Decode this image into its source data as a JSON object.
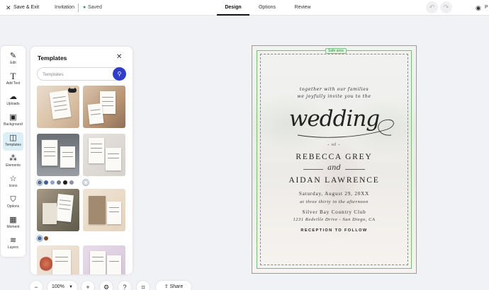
{
  "topbar": {
    "save_exit": "Save & Exit",
    "doc_type": "Invitation",
    "status": "Saved",
    "tabs": [
      {
        "label": "Design",
        "active": true
      },
      {
        "label": "Options",
        "active": false
      },
      {
        "label": "Review",
        "active": false
      }
    ],
    "preview_label": "P"
  },
  "tools": [
    {
      "label": "Edit",
      "icon": "magic-wand-icon"
    },
    {
      "label": "Add Text",
      "icon": "text-icon"
    },
    {
      "label": "Uploads",
      "icon": "cloud-upload-icon"
    },
    {
      "label": "Background",
      "icon": "image-icon"
    },
    {
      "label": "Templates",
      "icon": "templates-icon",
      "active": true
    },
    {
      "label": "Elements",
      "icon": "elements-icon"
    },
    {
      "label": "Icons",
      "icon": "star-icon"
    },
    {
      "label": "Options",
      "icon": "shirt-icon"
    },
    {
      "label": "Moment",
      "icon": "calendar-icon"
    },
    {
      "label": "Layers",
      "icon": "layers-icon"
    }
  ],
  "templates_panel": {
    "title": "Templates",
    "search_placeholder": "Templates",
    "more_label": "•••",
    "swatches_row1": [
      "#5b6f8c",
      "#3f5f9a",
      "#8fa2c4",
      "#6f7784",
      "#1b1b1b",
      "#8e8ea8"
    ],
    "swatches_row1b": [
      "#ffffff"
    ],
    "swatches_row2": [
      "#4f6fa6",
      "#7a4a2a"
    ]
  },
  "invitation": {
    "safe_area": "Safe area",
    "line1": "together with our families",
    "line2": "we joyfully invite you to the",
    "headline": "wedding",
    "of": "- of -",
    "name1": "REBECCA GREY",
    "and": "and",
    "name2": "AIDAN LAWRENCE",
    "date": "Saturday, August 29, 20XX",
    "time": "at three thirty in the afternoon",
    "venue": "Silver Bay Country Club",
    "address": "1231 Redville Drive - San Diego, CA",
    "reception": "RECEPTION TO FOLLOW"
  },
  "bottom_toolbar": {
    "zoom": "100%",
    "share": "Share"
  },
  "colors": {
    "accent": "#2f3ec8",
    "active_tool_bg": "#dceff7",
    "safe_area": "#6fbf7e",
    "saved_dot": "#2a9d5c"
  }
}
